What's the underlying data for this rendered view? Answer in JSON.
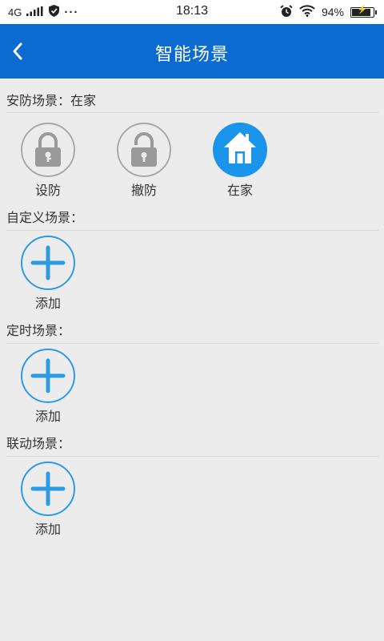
{
  "status_bar": {
    "network": "4G",
    "time": "18:13",
    "battery_text": "94%",
    "battery_level": 0.94,
    "icons": [
      "signal-icon",
      "shield-icon",
      "more-icon",
      "alarm-icon",
      "wifi-icon",
      "battery-icon"
    ]
  },
  "app_bar": {
    "title": "智能场景",
    "back_icon": "chevron-left-icon",
    "color": "#0b6bd0"
  },
  "security": {
    "title": "安防场景：在家",
    "items": [
      {
        "label": "设防",
        "icon": "lock-closed-icon",
        "active": false
      },
      {
        "label": "撤防",
        "icon": "lock-open-icon",
        "active": false
      },
      {
        "label": "在家",
        "icon": "home-icon",
        "active": true
      }
    ],
    "active_color": "#1b95ec"
  },
  "custom": {
    "title": "自定义场景：",
    "add_label": "添加"
  },
  "timed": {
    "title": "定时场景：",
    "add_label": "添加"
  },
  "linked": {
    "title": "联动场景：",
    "add_label": "添加"
  },
  "add_color": "#2c9be3"
}
